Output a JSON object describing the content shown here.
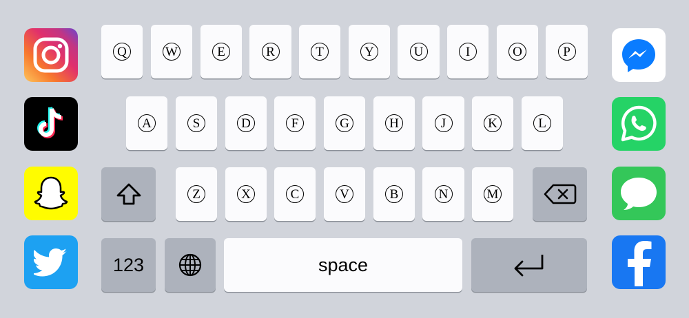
{
  "keyboard": {
    "row1": [
      "Q",
      "W",
      "E",
      "R",
      "T",
      "Y",
      "U",
      "I",
      "O",
      "P"
    ],
    "row2": [
      "A",
      "S",
      "D",
      "F",
      "G",
      "H",
      "J",
      "K",
      "L"
    ],
    "row3": [
      "Z",
      "X",
      "C",
      "V",
      "B",
      "N",
      "M"
    ],
    "numbers_label": "123",
    "space_label": "space",
    "icons": {
      "shift": "shift-icon",
      "backspace": "backspace-icon",
      "globe": "globe-icon",
      "return": "return-icon"
    }
  },
  "apps_left": [
    "instagram-icon",
    "tiktok-icon",
    "snapchat-icon",
    "twitter-icon"
  ],
  "apps_right": [
    "messenger-icon",
    "whatsapp-icon",
    "messages-icon",
    "facebook-icon"
  ],
  "colors": {
    "background": "#d1d4db",
    "key": "#fbfbfd",
    "special_key": "#adb2bc",
    "snapchat": "#fffc00",
    "twitter": "#1da1f2",
    "facebook": "#1877f2",
    "whatsapp": "#25d366",
    "messages": "#34c759",
    "messenger": "#0a7cff"
  }
}
